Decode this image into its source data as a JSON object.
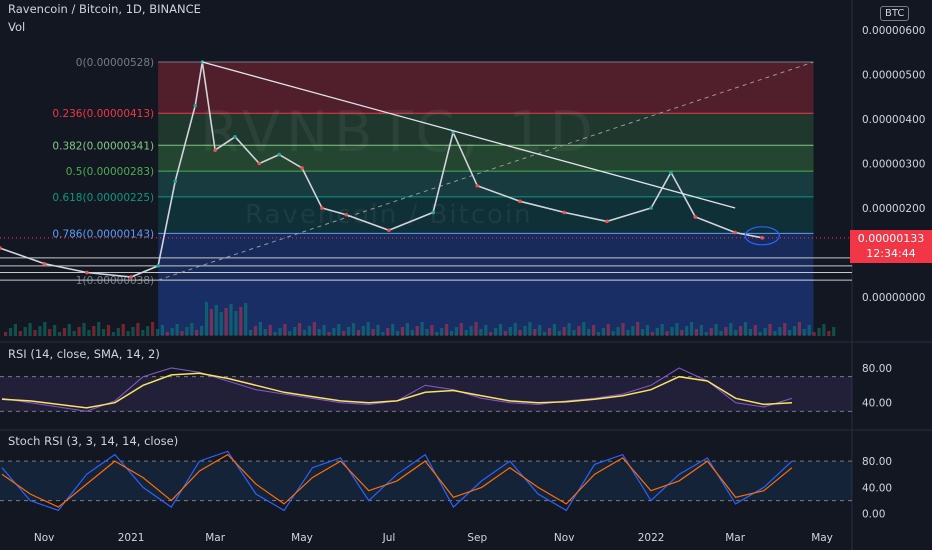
{
  "header": {
    "symbol_line": "Ravencoin / Bitcoin, 1D, BINANCE",
    "volume_label": "Vol",
    "currency_badge": "BTC"
  },
  "watermark": {
    "ticker": "RVNBTC, 1D",
    "name": "Ravencoin / Bitcoin"
  },
  "current_price": {
    "value": "0.00000133",
    "countdown": "12:34:44"
  },
  "colors": {
    "background": "#131722",
    "price_tag": "#f23645",
    "rsi_line": "#7e57c2",
    "rsi_ma": "#f7e45f",
    "stoch_k": "#2962ff",
    "stoch_d": "#ff6d00"
  },
  "chart_data": [
    {
      "type": "line",
      "title": "Ravencoin / Bitcoin, 1D, BINANCE",
      "x_tick_labels": [
        "Nov",
        "2021",
        "Mar",
        "May",
        "Jul",
        "Sep",
        "Nov",
        "2022",
        "Mar",
        "May"
      ],
      "y_tick_labels": [
        "0.00000600",
        "0.00000500",
        "0.00000400",
        "0.00000300",
        "0.00000200",
        "0.00000000"
      ],
      "ylim": [
        0,
        6.2e-06
      ],
      "series": [
        {
          "x": [
            "2020-10-01",
            "2020-11-01",
            "2020-12-01",
            "2021-01-01",
            "2021-01-20",
            "2021-02-01",
            "2021-02-15",
            "2021-02-20",
            "2021-03-01",
            "2021-03-15",
            "2021-04-01",
            "2021-04-15",
            "2021-05-01",
            "2021-05-15",
            "2021-06-01",
            "2021-07-01",
            "2021-08-01",
            "2021-08-15",
            "2021-09-01",
            "2021-10-01",
            "2021-11-01",
            "2021-12-01",
            "2022-01-01",
            "2022-01-15",
            "2022-02-01",
            "2022-03-01",
            "2022-03-20"
          ],
          "values": [
            1.1e-06,
            7.5e-07,
            5.5e-07,
            4.5e-07,
            7e-07,
            2.6e-06,
            4.3e-06,
            5.28e-06,
            3.3e-06,
            3.6e-06,
            3e-06,
            3.2e-06,
            2.9e-06,
            2e-06,
            1.85e-06,
            1.5e-06,
            1.9e-06,
            3.7e-06,
            2.5e-06,
            2.15e-06,
            1.9e-06,
            1.7e-06,
            2e-06,
            2.8e-06,
            1.8e-06,
            1.45e-06,
            1.33e-06
          ]
        }
      ],
      "fibonacci": [
        {
          "label": "0(0.00000528)",
          "value": 5.28e-06
        },
        {
          "label": "0.236(0.00000413)",
          "value": 4.13e-06
        },
        {
          "label": "0.382(0.00000341)",
          "value": 3.41e-06
        },
        {
          "label": "0.5(0.00000283)",
          "value": 2.83e-06
        },
        {
          "label": "0.618(0.00000225)",
          "value": 2.25e-06
        },
        {
          "label": "0.786(0.00000143)",
          "value": 1.43e-06
        },
        {
          "label": "1(0.00000038)",
          "value": 3.8e-07
        }
      ],
      "trendline": {
        "from": [
          "2021-02-20",
          5.28e-06
        ],
        "to": [
          "2022-03-01",
          2e-06
        ]
      }
    },
    {
      "type": "line",
      "title": "RSI (14, close, SMA, 14, 2)",
      "y_tick_labels": [
        "80.00",
        "40.00"
      ],
      "ylim": [
        20,
        95
      ],
      "bands": [
        70,
        30
      ],
      "series": [
        {
          "values": [
            45,
            40,
            35,
            30,
            42,
            70,
            80,
            75,
            65,
            55,
            50,
            45,
            40,
            38,
            42,
            60,
            55,
            45,
            40,
            38,
            42,
            45,
            50,
            60,
            80,
            65,
            40,
            35,
            45
          ]
        },
        {
          "values": [
            44,
            42,
            38,
            34,
            40,
            60,
            72,
            74,
            68,
            60,
            52,
            47,
            42,
            40,
            42,
            52,
            54,
            48,
            42,
            40,
            41,
            44,
            48,
            55,
            70,
            65,
            45,
            38,
            40
          ]
        }
      ]
    },
    {
      "type": "line",
      "title": "Stoch RSI (3, 3, 14, 14, close)",
      "y_tick_labels": [
        "80.00",
        "40.00",
        "0.00"
      ],
      "ylim": [
        -5,
        100
      ],
      "bands": [
        80,
        20
      ],
      "series": [
        {
          "values": [
            70,
            20,
            5,
            60,
            90,
            40,
            10,
            80,
            95,
            30,
            5,
            70,
            85,
            20,
            60,
            90,
            10,
            50,
            80,
            30,
            5,
            75,
            90,
            20,
            60,
            85,
            15,
            40,
            80
          ]
        },
        {
          "values": [
            60,
            30,
            10,
            45,
            80,
            55,
            20,
            65,
            90,
            45,
            15,
            55,
            80,
            35,
            50,
            80,
            25,
            40,
            70,
            40,
            15,
            60,
            85,
            35,
            50,
            80,
            25,
            35,
            70
          ]
        }
      ]
    }
  ]
}
